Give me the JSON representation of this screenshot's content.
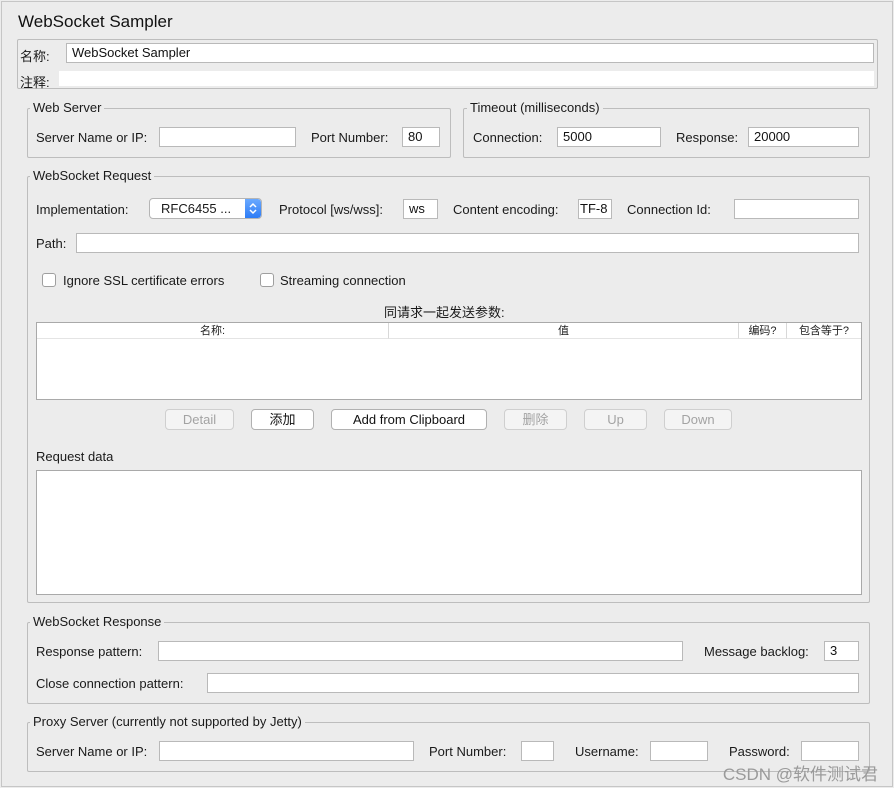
{
  "title": "WebSocket Sampler",
  "name": {
    "label": "名称:",
    "value": "WebSocket Sampler"
  },
  "comment": {
    "label": "注释:",
    "value": ""
  },
  "web_server": {
    "legend": "Web Server",
    "server_label": "Server Name or IP:",
    "server_value": "",
    "port_label": "Port Number:",
    "port_value": "80"
  },
  "timeout": {
    "legend": "Timeout (milliseconds)",
    "connection_label": "Connection:",
    "connection_value": "5000",
    "response_label": "Response:",
    "response_value": "20000"
  },
  "request": {
    "legend": "WebSocket Request",
    "implementation_label": "Implementation:",
    "implementation_value": "RFC6455 ...",
    "protocol_label": "Protocol [ws/wss]:",
    "protocol_value": "ws",
    "encoding_label": "Content encoding:",
    "encoding_value": "TF-8",
    "connection_id_label": "Connection Id:",
    "connection_id_value": "",
    "path_label": "Path:",
    "path_value": "",
    "ignore_ssl_label": "Ignore SSL certificate errors",
    "ignore_ssl_checked": false,
    "streaming_label": "Streaming connection",
    "streaming_checked": false,
    "params_title": "同请求一起发送参数:",
    "columns": [
      "名称:",
      "值",
      "编码?",
      "包含等于?"
    ],
    "buttons": {
      "detail": "Detail",
      "add": "添加",
      "add_clipboard": "Add from Clipboard",
      "delete": "删除",
      "up": "Up",
      "down": "Down"
    },
    "request_data_label": "Request data",
    "request_data_value": ""
  },
  "response": {
    "legend": "WebSocket Response",
    "pattern_label": "Response pattern:",
    "pattern_value": "",
    "backlog_label": "Message backlog:",
    "backlog_value": "3",
    "close_label": "Close connection pattern:",
    "close_value": ""
  },
  "proxy": {
    "legend": "Proxy Server (currently not supported by Jetty)",
    "server_label": "Server Name or IP:",
    "server_value": "",
    "port_label": "Port Number:",
    "port_value": "",
    "username_label": "Username:",
    "username_value": "",
    "password_label": "Password:",
    "password_value": ""
  },
  "watermark": "CSDN @软件测试君",
  "colors": {
    "accent": "#2d7cf6",
    "background": "#ececec",
    "border": "#bdbdbd"
  },
  "icons": {
    "select_arrows": "chevron-up-down-icon"
  }
}
